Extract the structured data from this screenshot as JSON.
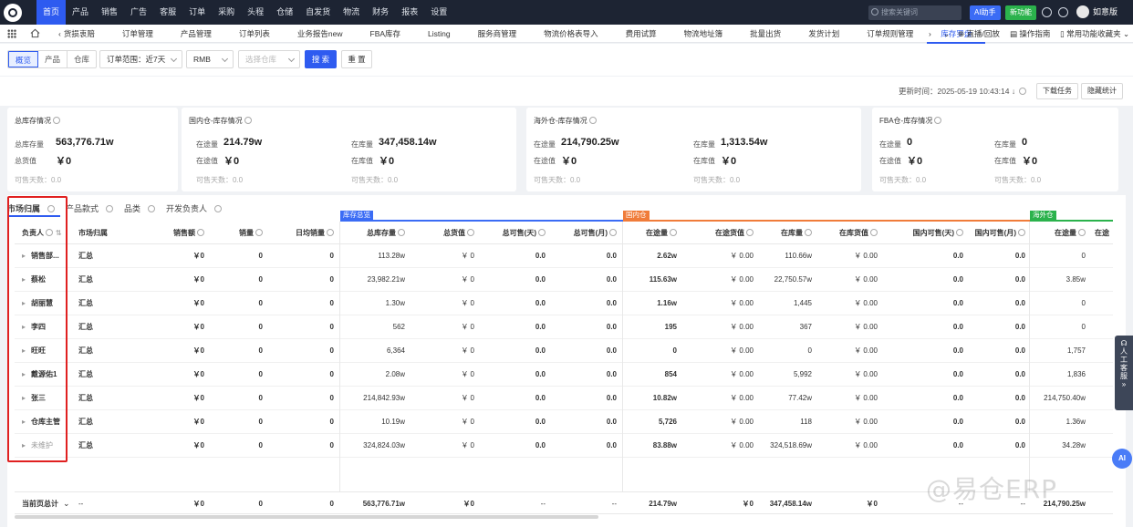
{
  "topnav": {
    "menu": [
      "首页",
      "产品",
      "销售",
      "广告",
      "客服",
      "订单",
      "采购",
      "头程",
      "仓储",
      "自发货",
      "物流",
      "财务",
      "报表",
      "设置"
    ],
    "active_index": 0,
    "search_placeholder": "搜索关键词",
    "ai_label": "AI助手",
    "new_feature_label": "新功能",
    "user_name": "如意版"
  },
  "tabbar": {
    "back_label": "货损衷赔",
    "tabs": [
      "订单管理",
      "产品管理",
      "订单列表",
      "业务报告new",
      "FBA库存",
      "Listing",
      "服务商管理",
      "物流价格表导入",
      "费用试算",
      "物流地址簿",
      "批量出货",
      "发货计划",
      "订单规则管理",
      "库存罗盘"
    ],
    "active_index": 13,
    "live_label": "直播/回放",
    "guide_label": "操作指南",
    "favorites_label": "常用功能收藏夹"
  },
  "filters": {
    "segments": [
      "概览",
      "产品",
      "仓库"
    ],
    "active_segment": 0,
    "order_range": "订单范围：近7天",
    "currency": "RMB",
    "warehouse_placeholder": "选择仓库",
    "search_label": "搜 索",
    "reset_label": "重 置"
  },
  "update": {
    "text": "更新时间：2025-05-19 10:43:14",
    "download_label": "下载任务",
    "hide_label": "隐藏统计"
  },
  "cards": [
    {
      "title": "总库存情况",
      "stock_label": "总库存量",
      "stock": "563,776.71w",
      "value_label": "总货值",
      "value": "￥0",
      "days": "可售天数：0.0"
    },
    {
      "title": "国内仓-库存情况",
      "transit_label": "在途量",
      "transit": "214.79w",
      "instock_label": "在库量",
      "instock": "347,458.14w",
      "transit_value_label": "在途值",
      "transit_value": "￥0",
      "instock_value_label": "在库值",
      "instock_value": "￥0",
      "days1": "可售天数：0.0",
      "days2": "可售天数：0.0"
    },
    {
      "title": "海外仓-库存情况",
      "transit_label": "在途量",
      "transit": "214,790.25w",
      "instock_label": "在库量",
      "instock": "1,313.54w",
      "transit_value_label": "在途值",
      "transit_value": "￥0",
      "instock_value_label": "在库值",
      "instock_value": "￥0",
      "days1": "可售天数：0.0",
      "days2": "可售天数：0.0"
    },
    {
      "title": "FBA仓-库存情况",
      "transit_label": "在途量",
      "transit": "0",
      "instock_label": "在库量",
      "instock": "0",
      "transit_value_label": "在途值",
      "transit_value": "￥0",
      "instock_value_label": "在库值",
      "instock_value": "￥0",
      "days1": "可售天数：0.0",
      "days2": "可售天数：0.0"
    }
  ],
  "subtabs": [
    "市场归属",
    "产品款式",
    "品类",
    "开发负责人"
  ],
  "groups": {
    "overview": "库存总览",
    "domestic": "国内仓",
    "overseas": "海外仓"
  },
  "columns": [
    "负责人",
    "市场归属",
    "销售额",
    "销量",
    "日均销量",
    "总库存量",
    "总货值",
    "总可售(天)",
    "总可售(月)",
    "在途量",
    "在途货值",
    "在库量",
    "在库货值",
    "国内可售(天)",
    "国内可售(月)",
    "在途量",
    "在途"
  ],
  "rows": [
    {
      "owner": "销售部...",
      "market": "汇总",
      "sales": "￥0",
      "qty": "0",
      "daily": "0",
      "total_stock": "113.28w",
      "total_value": "￥ 0",
      "days": "0.0",
      "months": "0.0",
      "transit": "2.62w",
      "transit_value": "￥ 0.00",
      "instock": "110.66w",
      "instock_value": "￥ 0.00",
      "dom_days": "0.0",
      "dom_months": "0.0",
      "os_transit": "0"
    },
    {
      "owner": "蔡松",
      "market": "汇总",
      "sales": "￥0",
      "qty": "0",
      "daily": "0",
      "total_stock": "23,982.21w",
      "total_value": "￥ 0",
      "days": "0.0",
      "months": "0.0",
      "transit": "115.63w",
      "transit_value": "￥ 0.00",
      "instock": "22,750.57w",
      "instock_value": "￥ 0.00",
      "dom_days": "0.0",
      "dom_months": "0.0",
      "os_transit": "3.85w"
    },
    {
      "owner": "胡丽慧",
      "market": "汇总",
      "sales": "￥0",
      "qty": "0",
      "daily": "0",
      "total_stock": "1.30w",
      "total_value": "￥ 0",
      "days": "0.0",
      "months": "0.0",
      "transit": "1.16w",
      "transit_value": "￥ 0.00",
      "instock": "1,445",
      "instock_value": "￥ 0.00",
      "dom_days": "0.0",
      "dom_months": "0.0",
      "os_transit": "0"
    },
    {
      "owner": "李四",
      "market": "汇总",
      "sales": "￥0",
      "qty": "0",
      "daily": "0",
      "total_stock": "562",
      "total_value": "￥ 0",
      "days": "0.0",
      "months": "0.0",
      "transit": "195",
      "transit_value": "￥ 0.00",
      "instock": "367",
      "instock_value": "￥ 0.00",
      "dom_days": "0.0",
      "dom_months": "0.0",
      "os_transit": "0"
    },
    {
      "owner": "旺旺",
      "market": "汇总",
      "sales": "￥0",
      "qty": "0",
      "daily": "0",
      "total_stock": "6,364",
      "total_value": "￥ 0",
      "days": "0.0",
      "months": "0.0",
      "transit": "0",
      "transit_value": "￥ 0.00",
      "instock": "0",
      "instock_value": "￥ 0.00",
      "dom_days": "0.0",
      "dom_months": "0.0",
      "os_transit": "1,757"
    },
    {
      "owner": "戴源佑1",
      "market": "汇总",
      "sales": "￥0",
      "qty": "0",
      "daily": "0",
      "total_stock": "2.08w",
      "total_value": "￥ 0",
      "days": "0.0",
      "months": "0.0",
      "transit": "854",
      "transit_value": "￥ 0.00",
      "instock": "5,992",
      "instock_value": "￥ 0.00",
      "dom_days": "0.0",
      "dom_months": "0.0",
      "os_transit": "1,836"
    },
    {
      "owner": "张三",
      "market": "汇总",
      "sales": "￥0",
      "qty": "0",
      "daily": "0",
      "total_stock": "214,842.93w",
      "total_value": "￥ 0",
      "days": "0.0",
      "months": "0.0",
      "transit": "10.82w",
      "transit_value": "￥ 0.00",
      "instock": "77.42w",
      "instock_value": "￥ 0.00",
      "dom_days": "0.0",
      "dom_months": "0.0",
      "os_transit": "214,750.40w"
    },
    {
      "owner": "仓库主管",
      "market": "汇总",
      "sales": "￥0",
      "qty": "0",
      "daily": "0",
      "total_stock": "10.19w",
      "total_value": "￥ 0",
      "days": "0.0",
      "months": "0.0",
      "transit": "5,726",
      "transit_value": "￥ 0.00",
      "instock": "118",
      "instock_value": "￥ 0.00",
      "dom_days": "0.0",
      "dom_months": "0.0",
      "os_transit": "1.36w"
    },
    {
      "owner": "未维护",
      "market": "汇总",
      "sales": "￥0",
      "qty": "0",
      "daily": "0",
      "total_stock": "324,824.03w",
      "total_value": "￥ 0",
      "days": "0.0",
      "months": "0.0",
      "transit": "83.88w",
      "transit_value": "￥ 0.00",
      "instock": "324,518.69w",
      "instock_value": "￥ 0.00",
      "dom_days": "0.0",
      "dom_months": "0.0",
      "os_transit": "34.28w"
    }
  ],
  "footer": {
    "label": "当前页总计",
    "market": "--",
    "sales": "￥0",
    "qty": "0",
    "daily": "0",
    "total_stock": "563,776.71w",
    "total_value": "￥0",
    "days": "--",
    "months": "--",
    "transit": "214.79w",
    "transit_value": "￥0",
    "instock": "347,458.14w",
    "instock_value": "￥0",
    "dom_days": "--",
    "dom_months": "--",
    "os_transit": "214,790.25w"
  },
  "side_service": "人工客服",
  "ai_bubble": "AI",
  "watermark": "@易仓ERP",
  "colors": {
    "nav_bg": "#1d2433",
    "primary": "#2e5bf0",
    "overview_group": "#3b6cf5",
    "domestic_group": "#f07c3a",
    "overseas_group": "#2bb24c",
    "highlight": "#e02020"
  }
}
